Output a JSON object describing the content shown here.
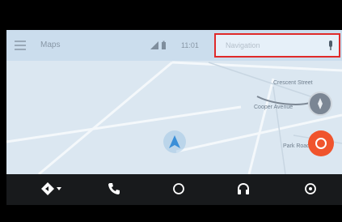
{
  "status_bar": {
    "menu_icon": "menu-icon",
    "map_label": "Maps",
    "signal_icon": "signal-battery-icon",
    "time": "11:01"
  },
  "search": {
    "placeholder": "Navigation",
    "mic_icon": "mic-icon",
    "highlight_color": "#e02a2a"
  },
  "map": {
    "street_labels": [
      "Cooper Avenue",
      "Crescent Street",
      "Park Road"
    ],
    "nav_icon": "navigation-arrow-icon",
    "compass_icon": "compass-icon",
    "action_icon": "pin-action-icon",
    "action_color": "#f0542d"
  },
  "bottom_nav": {
    "items": [
      {
        "icon": "navigation-dropdown-icon"
      },
      {
        "icon": "phone-icon"
      },
      {
        "icon": "home-circle-icon"
      },
      {
        "icon": "headphones-icon"
      },
      {
        "icon": "notifications-icon"
      }
    ]
  }
}
